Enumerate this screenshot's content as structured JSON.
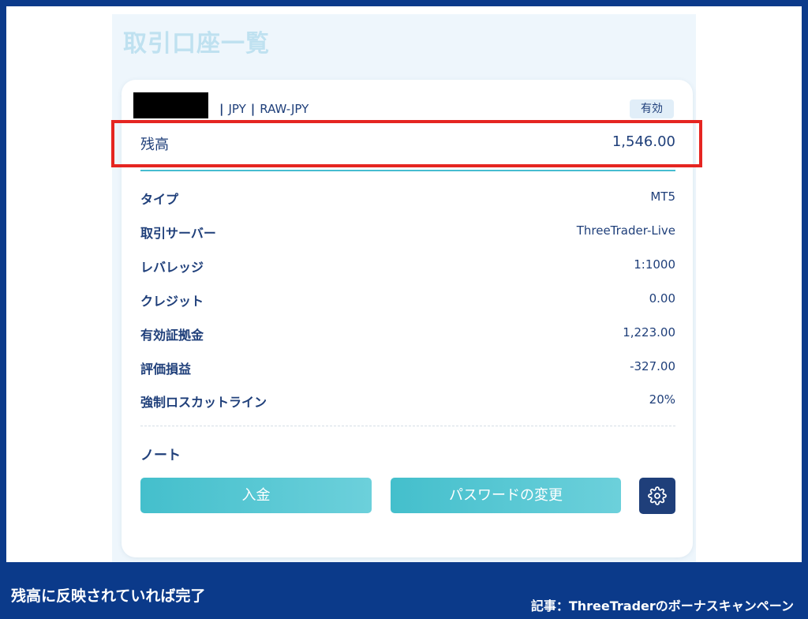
{
  "page": {
    "title": "取引口座一覧"
  },
  "account": {
    "currency": "JPY",
    "group": "RAW-JPY",
    "status_badge": "有効",
    "balance_label": "残高",
    "balance_value": "1,546.00"
  },
  "details": [
    {
      "label": "タイプ",
      "value": "MT5"
    },
    {
      "label": "取引サーバー",
      "value": "ThreeTrader-Live"
    },
    {
      "label": "レバレッジ",
      "value": "1:1000"
    },
    {
      "label": "クレジット",
      "value": "0.00"
    },
    {
      "label": "有効証拠金",
      "value": "1,223.00"
    },
    {
      "label": "評価損益",
      "value": "-327.00"
    },
    {
      "label": "強制ロスカットライン",
      "value": "20%"
    }
  ],
  "note": {
    "label": "ノート"
  },
  "actions": {
    "deposit_label": "入金",
    "change_password_label": "パスワードの変更",
    "settings_icon": "gear-icon"
  },
  "footer": {
    "caption": "残高に反映されていれば完了",
    "article": "記事：ThreeTraderのボーナスキャンペーン"
  },
  "colors": {
    "navy": "#1f3f7a",
    "teal": "#47bcd0",
    "highlight_red": "#e52521",
    "frame_blue": "#0b3a8a"
  }
}
